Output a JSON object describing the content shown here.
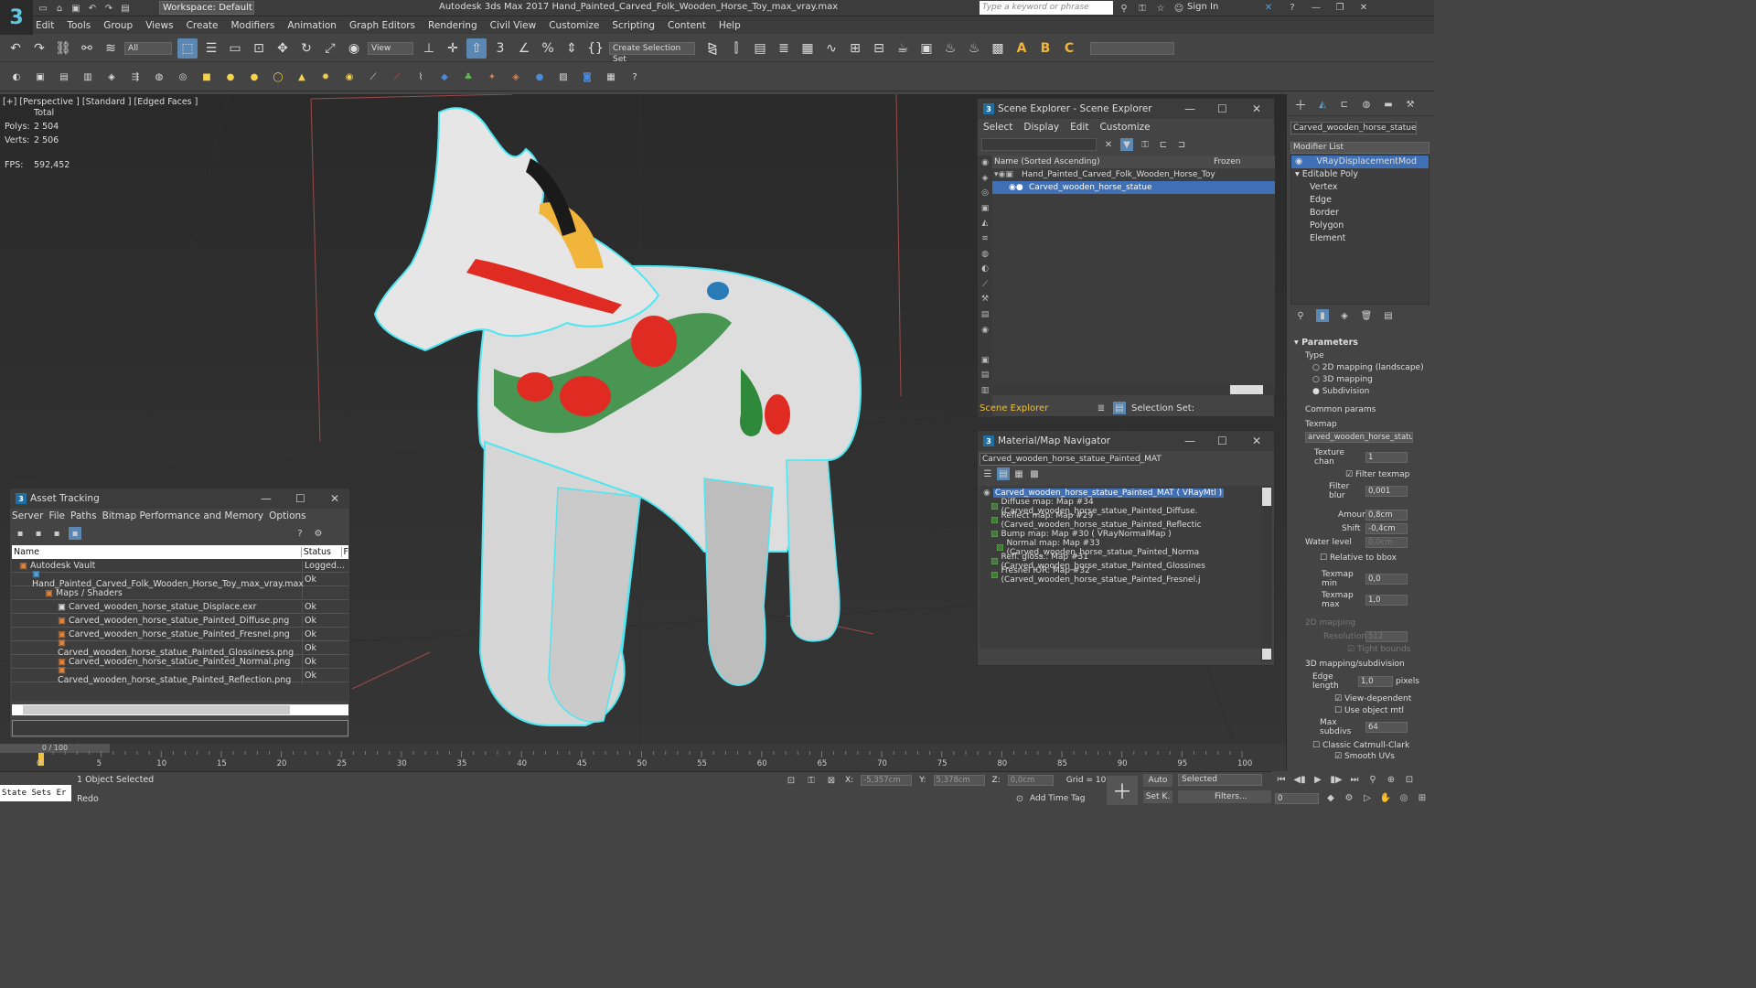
{
  "app": {
    "logo": "3",
    "workspace": "Workspace: Default",
    "title": "Autodesk 3ds Max 2017      Hand_Painted_Carved_Folk_Wooden_Horse_Toy_max_vray.max",
    "search_placeholder": "Type a keyword or phrase",
    "sign_in": "Sign In"
  },
  "menu": [
    "Edit",
    "Tools",
    "Group",
    "Views",
    "Create",
    "Modifiers",
    "Animation",
    "Graph Editors",
    "Rendering",
    "Civil View",
    "Customize",
    "Scripting",
    "Content",
    "Help"
  ],
  "toolbar": {
    "filter_all": "All",
    "view_dropdown": "View",
    "selection_set": "Create Selection Set"
  },
  "viewport": {
    "label": "[+] [Perspective ] [Standard ] [Edged Faces ]",
    "stats_total": "Total",
    "polys_label": "Polys:",
    "polys_value": "2 504",
    "verts_label": "Verts:",
    "verts_value": "2 506",
    "fps_label": "FPS:",
    "fps_value": "592,452"
  },
  "scene_explorer": {
    "title": "Scene Explorer - Scene Explorer",
    "menu": [
      "Select",
      "Display",
      "Edit",
      "Customize"
    ],
    "col_name": "Name (Sorted Ascending)",
    "col_frozen": "Frozen",
    "rows": [
      "Hand_Painted_Carved_Folk_Wooden_Horse_Toy",
      "Carved_wooden_horse_statue"
    ],
    "footer_left": "Scene Explorer",
    "footer_sel": "Selection Set:"
  },
  "material_nav": {
    "title": "Material/Map Navigator",
    "field": "Carved_wooden_horse_statue_Painted_MAT",
    "root": "Carved_wooden_horse_statue_Painted_MAT  ( VRayMtl )",
    "items": [
      "Diffuse map: Map #34 (Carved_wooden_horse_statue_Painted_Diffuse.",
      "Reflect map: Map #29 (Carved_wooden_horse_statue_Painted_Reflectic",
      "Bump map: Map #30  ( VRayNormalMap )",
      "Normal map: Map #33 (Carved_wooden_horse_statue_Painted_Norma",
      "Refl. gloss.: Map #31 (Carved_wooden_horse_statue_Painted_Glossines",
      "Fresnel IOR: Map #32 (Carved_wooden_horse_statue_Painted_Fresnel.j"
    ]
  },
  "asset_tracking": {
    "title": "Asset Tracking",
    "menu": [
      "Server",
      "File",
      "Paths",
      "Bitmap Performance and Memory",
      "Options"
    ],
    "col_name": "Name",
    "col_status": "Status",
    "col_extra": "F",
    "rows": [
      {
        "name": "Autodesk Vault",
        "status": "Logged..."
      },
      {
        "name": "Hand_Painted_Carved_Folk_Wooden_Horse_Toy_max_vray.max",
        "status": "Ok"
      },
      {
        "name": "Maps / Shaders",
        "status": ""
      },
      {
        "name": "Carved_wooden_horse_statue_Displace.exr",
        "status": "Ok"
      },
      {
        "name": "Carved_wooden_horse_statue_Painted_Diffuse.png",
        "status": "Ok"
      },
      {
        "name": "Carved_wooden_horse_statue_Painted_Fresnel.png",
        "status": "Ok"
      },
      {
        "name": "Carved_wooden_horse_statue_Painted_Glossiness.png",
        "status": "Ok"
      },
      {
        "name": "Carved_wooden_horse_statue_Painted_Normal.png",
        "status": "Ok"
      },
      {
        "name": "Carved_wooden_horse_statue_Painted_Reflection.png",
        "status": "Ok"
      }
    ]
  },
  "command_panel": {
    "object_name": "Carved_wooden_horse_statue",
    "modifier_list": "Modifier List",
    "stack": [
      "VRayDisplacementMod",
      "Editable Poly",
      "Vertex",
      "Edge",
      "Border",
      "Polygon",
      "Element"
    ],
    "rollout": "Parameters",
    "type_label": "Type",
    "types": [
      "2D mapping (landscape)",
      "3D mapping",
      "Subdivision"
    ],
    "common": "Common params",
    "texmap_label": "Texmap",
    "texmap_value": "arved_wooden_horse_statue_D",
    "texture_chan_label": "Texture chan",
    "texture_chan": "1",
    "filter_texmap": "Filter texmap",
    "filter_blur_label": "Filter blur",
    "filter_blur": "0,001",
    "amount_label": "Amount",
    "amount": "0,8cm",
    "shift_label": "Shift",
    "shift": "-0,4cm",
    "water_label": "Water level",
    "water": "0,0cm",
    "relative": "Relative to bbox",
    "texmap_min_label": "Texmap min",
    "texmap_min": "0,0",
    "texmap_max_label": "Texmap max",
    "texmap_max": "1,0",
    "mapping2d": "2D mapping",
    "resolution_label": "Resolution",
    "resolution": "512",
    "tight": "Tight bounds",
    "mapping3d": "3D mapping/subdivision",
    "edge_length_label": "Edge length",
    "edge_length": "1,0",
    "pixels": "pixels",
    "view_dependent": "View-dependent",
    "use_object": "Use object mtl",
    "max_subdivs_label": "Max subdivs",
    "max_subdivs": "64",
    "catmull": "Classic Catmull-Clark",
    "smooth_uvs": "Smooth UVs"
  },
  "timeline": {
    "frame": "0 / 100",
    "ticks": [
      "0",
      "5",
      "10",
      "15",
      "20",
      "25",
      "30",
      "35",
      "40",
      "45",
      "50",
      "55",
      "60",
      "65",
      "70",
      "75",
      "80",
      "85",
      "90",
      "95",
      "100"
    ]
  },
  "status": {
    "state_sets": "State Sets Er",
    "selected": "1 Object Selected",
    "redo": "Redo",
    "x_label": "X:",
    "x_value": "-5,357cm",
    "y_label": "Y:",
    "y_value": "5,378cm",
    "z_label": "Z:",
    "z_value": "0,0cm",
    "grid": "Grid = 10,0cm",
    "add_time_tag": "Add Time Tag",
    "auto": "Auto",
    "selected_dd": "Selected",
    "set_key": "Set K.",
    "filters": "Filters...",
    "frame_value": "0"
  },
  "colors": {
    "accent": "#5b87b3",
    "selection": "#3f6fb5",
    "wire": "#4ee6f0"
  }
}
